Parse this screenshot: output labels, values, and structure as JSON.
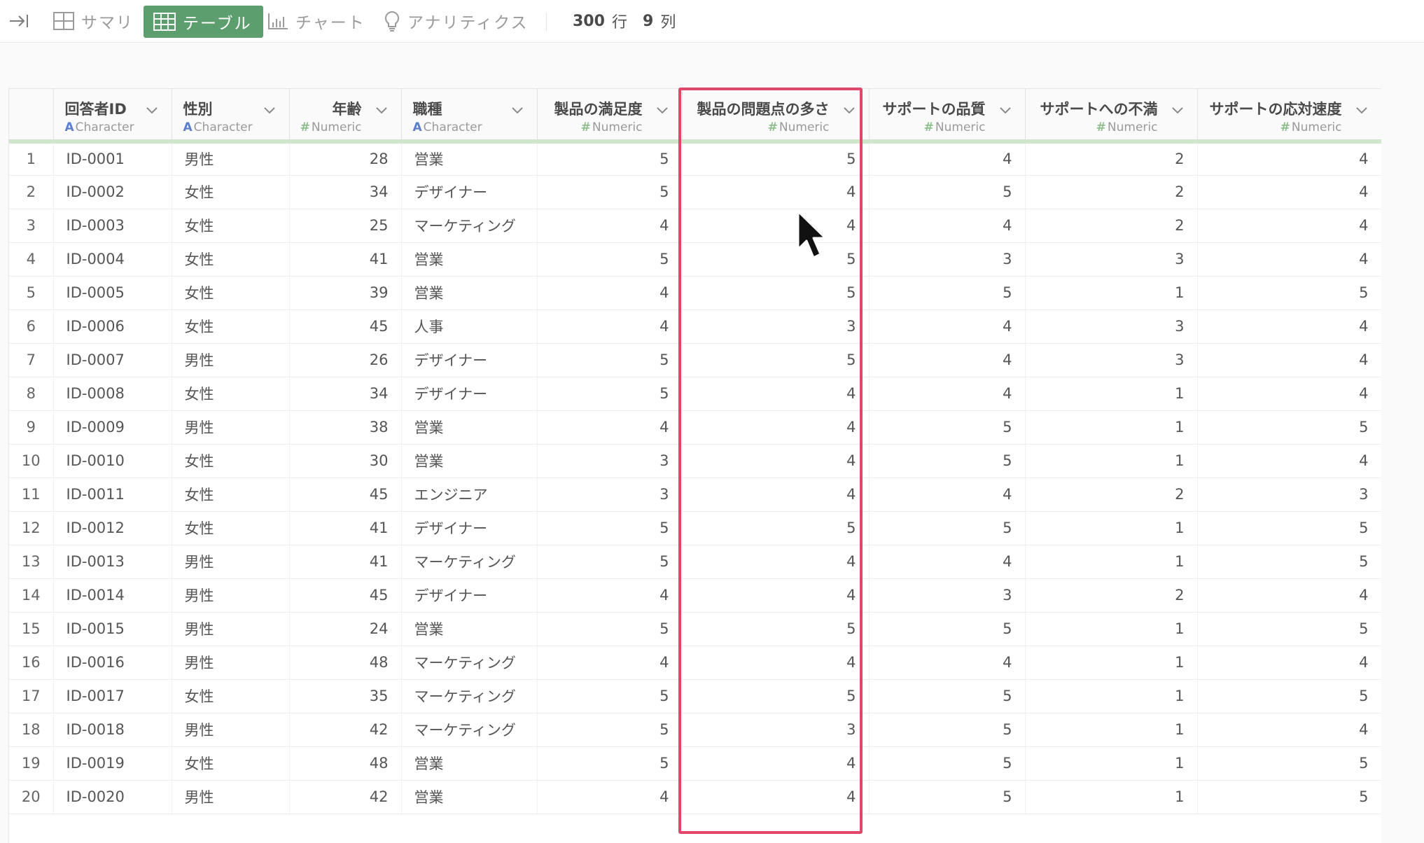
{
  "toolbar": {
    "tabs": [
      {
        "label": "サマリ",
        "icon": "summary-grid-icon"
      },
      {
        "label": "テーブル",
        "icon": "table-icon"
      },
      {
        "label": "チャート",
        "icon": "bar-chart-icon"
      },
      {
        "label": "アナリティクス",
        "icon": "lightbulb-icon"
      }
    ],
    "active_tab": "テーブル",
    "rows_value": "300",
    "rows_unit": "行",
    "cols_value": "9",
    "cols_unit": "列"
  },
  "colors": {
    "accent": "#5d9e6e",
    "highlight": "#e0476b",
    "type_char": "#5a7fd0",
    "type_num": "#8fbf8f"
  },
  "columns": [
    {
      "name": "回答者ID",
      "type": "Character",
      "mark": "A"
    },
    {
      "name": "性別",
      "type": "Character",
      "mark": "A"
    },
    {
      "name": "年齢",
      "type": "Numeric",
      "mark": "#"
    },
    {
      "name": "職種",
      "type": "Character",
      "mark": "A"
    },
    {
      "name": "製品の満足度",
      "type": "Numeric",
      "mark": "#"
    },
    {
      "name": "製品の問題点の多さ",
      "type": "Numeric",
      "mark": "#"
    },
    {
      "name": "サポートの品質",
      "type": "Numeric",
      "mark": "#"
    },
    {
      "name": "サポートへの不満",
      "type": "Numeric",
      "mark": "#"
    },
    {
      "name": "サポートの応対速度",
      "type": "Numeric",
      "mark": "#"
    }
  ],
  "highlighted_column": "製品の問題点の多さ",
  "rows": [
    [
      "1",
      "ID-0001",
      "男性",
      "28",
      "営業",
      "5",
      "5",
      "4",
      "2",
      "4"
    ],
    [
      "2",
      "ID-0002",
      "女性",
      "34",
      "デザイナー",
      "5",
      "4",
      "5",
      "2",
      "4"
    ],
    [
      "3",
      "ID-0003",
      "女性",
      "25",
      "マーケティング",
      "4",
      "4",
      "4",
      "2",
      "4"
    ],
    [
      "4",
      "ID-0004",
      "女性",
      "41",
      "営業",
      "5",
      "5",
      "3",
      "3",
      "4"
    ],
    [
      "5",
      "ID-0005",
      "女性",
      "39",
      "営業",
      "4",
      "5",
      "5",
      "1",
      "5"
    ],
    [
      "6",
      "ID-0006",
      "女性",
      "45",
      "人事",
      "4",
      "3",
      "4",
      "3",
      "4"
    ],
    [
      "7",
      "ID-0007",
      "男性",
      "26",
      "デザイナー",
      "5",
      "5",
      "4",
      "3",
      "4"
    ],
    [
      "8",
      "ID-0008",
      "女性",
      "34",
      "デザイナー",
      "5",
      "4",
      "4",
      "1",
      "4"
    ],
    [
      "9",
      "ID-0009",
      "男性",
      "38",
      "営業",
      "4",
      "4",
      "5",
      "1",
      "5"
    ],
    [
      "10",
      "ID-0010",
      "女性",
      "30",
      "営業",
      "3",
      "4",
      "5",
      "1",
      "4"
    ],
    [
      "11",
      "ID-0011",
      "女性",
      "45",
      "エンジニア",
      "3",
      "4",
      "4",
      "2",
      "3"
    ],
    [
      "12",
      "ID-0012",
      "女性",
      "41",
      "デザイナー",
      "5",
      "5",
      "5",
      "1",
      "5"
    ],
    [
      "13",
      "ID-0013",
      "男性",
      "41",
      "マーケティング",
      "5",
      "4",
      "4",
      "1",
      "5"
    ],
    [
      "14",
      "ID-0014",
      "男性",
      "45",
      "デザイナー",
      "4",
      "4",
      "3",
      "2",
      "4"
    ],
    [
      "15",
      "ID-0015",
      "男性",
      "24",
      "営業",
      "5",
      "5",
      "5",
      "1",
      "5"
    ],
    [
      "16",
      "ID-0016",
      "男性",
      "48",
      "マーケティング",
      "4",
      "4",
      "4",
      "1",
      "4"
    ],
    [
      "17",
      "ID-0017",
      "女性",
      "35",
      "マーケティング",
      "5",
      "5",
      "5",
      "1",
      "5"
    ],
    [
      "18",
      "ID-0018",
      "男性",
      "42",
      "マーケティング",
      "5",
      "3",
      "5",
      "1",
      "4"
    ],
    [
      "19",
      "ID-0019",
      "女性",
      "48",
      "営業",
      "5",
      "4",
      "5",
      "1",
      "5"
    ],
    [
      "20",
      "ID-0020",
      "男性",
      "42",
      "営業",
      "4",
      "4",
      "5",
      "1",
      "5"
    ]
  ]
}
